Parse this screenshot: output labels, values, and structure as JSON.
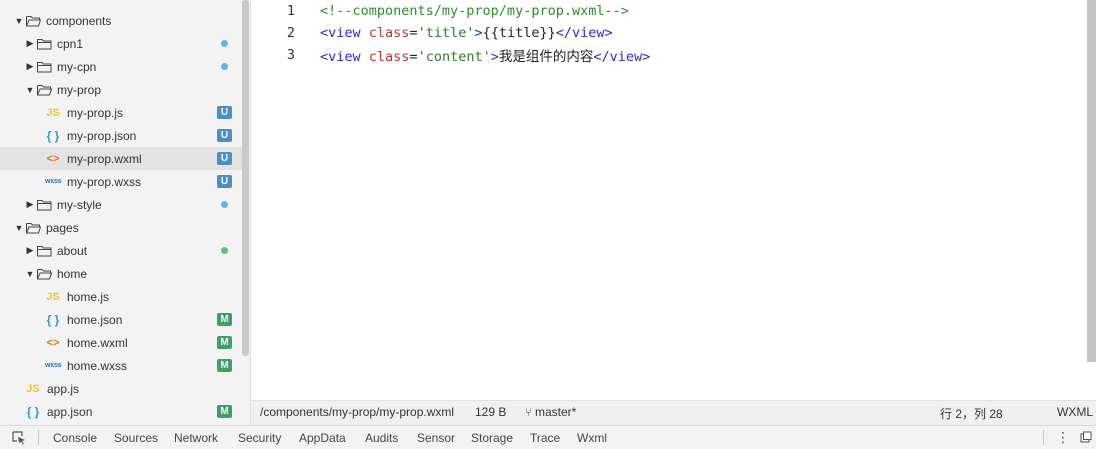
{
  "file_tree": [
    {
      "label": "components",
      "kind": "folder",
      "expanded": true,
      "depth": 0
    },
    {
      "label": "cpn1",
      "kind": "folder",
      "expanded": false,
      "depth": 1,
      "marker": "dot-blue"
    },
    {
      "label": "my-cpn",
      "kind": "folder",
      "expanded": false,
      "depth": 1,
      "marker": "dot-blue"
    },
    {
      "label": "my-prop",
      "kind": "folder",
      "expanded": true,
      "depth": 1
    },
    {
      "label": "my-prop.js",
      "kind": "js",
      "depth": 2,
      "badge": "U"
    },
    {
      "label": "my-prop.json",
      "kind": "json",
      "depth": 2,
      "badge": "U"
    },
    {
      "label": "my-prop.wxml",
      "kind": "wxml",
      "depth": 2,
      "badge": "U",
      "selected": true
    },
    {
      "label": "my-prop.wxss",
      "kind": "wxss",
      "depth": 2,
      "badge": "U"
    },
    {
      "label": "my-style",
      "kind": "folder",
      "expanded": false,
      "depth": 1,
      "marker": "dot-blue"
    },
    {
      "label": "pages",
      "kind": "folder",
      "expanded": true,
      "depth": 0
    },
    {
      "label": "about",
      "kind": "folder",
      "expanded": false,
      "depth": 1,
      "marker": "dot-green"
    },
    {
      "label": "home",
      "kind": "folder",
      "expanded": true,
      "depth": 1
    },
    {
      "label": "home.js",
      "kind": "js",
      "depth": 2
    },
    {
      "label": "home.json",
      "kind": "json",
      "depth": 2,
      "badge": "M"
    },
    {
      "label": "home.wxml",
      "kind": "wxml",
      "depth": 2,
      "badge": "M"
    },
    {
      "label": "home.wxss",
      "kind": "wxss",
      "depth": 2,
      "badge": "M"
    },
    {
      "label": "app.js",
      "kind": "js",
      "depth": 1
    },
    {
      "label": "app.json",
      "kind": "json",
      "depth": 1,
      "badge": "M"
    }
  ],
  "icon_glyphs": {
    "js": "JS",
    "json": "{ }",
    "wxml": "<>",
    "wxss": "wxss"
  },
  "editor": {
    "lines": [
      {
        "num": "1",
        "tokens": [
          {
            "t": "<!--components/my-prop/my-prop.wxml-->",
            "c": "comment"
          }
        ]
      },
      {
        "num": "2",
        "tokens": [
          {
            "t": "<view ",
            "c": "tag"
          },
          {
            "t": "class",
            "c": "attr"
          },
          {
            "t": "=",
            "c": "text"
          },
          {
            "t": "'title'",
            "c": "str"
          },
          {
            "t": ">",
            "c": "tag"
          },
          {
            "t": "{{title}}",
            "c": "text"
          },
          {
            "t": "</view>",
            "c": "tag"
          }
        ]
      },
      {
        "num": "3",
        "tokens": [
          {
            "t": "<view ",
            "c": "tag"
          },
          {
            "t": "class",
            "c": "attr"
          },
          {
            "t": "=",
            "c": "text"
          },
          {
            "t": "'content'",
            "c": "str"
          },
          {
            "t": ">",
            "c": "tag"
          },
          {
            "t": "我是组件的内容",
            "c": "text"
          },
          {
            "t": "</view>",
            "c": "tag"
          }
        ]
      }
    ]
  },
  "statusbar": {
    "path": "/components/my-prop/my-prop.wxml",
    "size": "129 B",
    "branch": "master*",
    "cursor": "行 2，列 28",
    "language": "WXML"
  },
  "devtools": {
    "tabs": [
      "Console",
      "Sources",
      "Network",
      "Security",
      "AppData",
      "Audits",
      "Sensor",
      "Storage",
      "Trace",
      "Wxml"
    ]
  }
}
